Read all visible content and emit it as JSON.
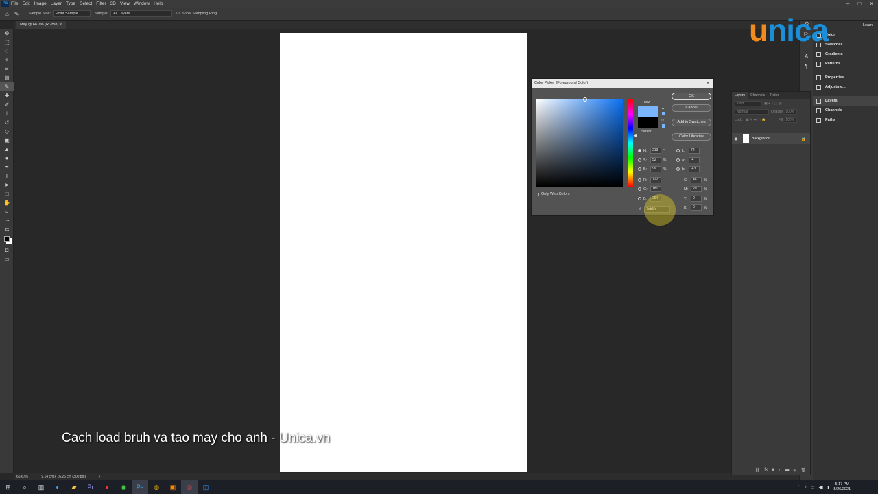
{
  "menubar": {
    "app_icon": "Ps",
    "items": [
      "File",
      "Edit",
      "Image",
      "Layer",
      "Type",
      "Select",
      "Filter",
      "3D",
      "View",
      "Window",
      "Help"
    ]
  },
  "options": {
    "sample_size_label": "Sample Size:",
    "sample_size_value": "Point Sample",
    "sample_label": "Sample:",
    "sample_value": "All Layers",
    "show_ring_label": "Show Sampling Ring"
  },
  "document": {
    "tab_title": "Mây @ 66.7% (RGB/8)",
    "zoom": "66.67%",
    "doc_info": "9.14 cm x 16.26 cm (300 ppi)"
  },
  "right_panel": {
    "items": [
      "Color",
      "Swatches",
      "Gradients",
      "Patterns",
      "Properties",
      "Adjustme...",
      "Layers",
      "Channels",
      "Paths"
    ],
    "learn": "Learn"
  },
  "layers_panel": {
    "tabs": [
      "Layers",
      "Channels",
      "Paths"
    ],
    "kind_placeholder": "Kind",
    "blend_mode": "Normal",
    "opacity_label": "Opacity:",
    "opacity_value": "100%",
    "lock_label": "Lock:",
    "fill_label": "Fill:",
    "fill_value": "100%",
    "layer_name": "Background"
  },
  "color_picker": {
    "title": "Color Picker (Foreground Color)",
    "new_label": "new",
    "current_label": "current",
    "buttons": {
      "ok": "OK",
      "cancel": "Cancel",
      "add": "Add to Swatches",
      "libraries": "Color Libraries"
    },
    "new_color": "#7ab5fe",
    "current_color": "#000000",
    "only_web": "Only Web Colors",
    "hsb": {
      "H": "213",
      "S": "52",
      "B": "99",
      "h_unit": "°",
      "s_unit": "%",
      "b_unit": "%"
    },
    "rgb": {
      "R": "122",
      "G": "181",
      "B": "254"
    },
    "lab": {
      "L": "72",
      "a": "-4",
      "b": "-43"
    },
    "cmyk": {
      "C": "46",
      "M": "20",
      "Y": "0",
      "K": "0",
      "unit": "%"
    },
    "hex_label": "#",
    "hex_value": "7ab5fe"
  },
  "logo": {
    "text1": "u",
    "text2": "nica"
  },
  "caption": "Cach load bruh  va tao may cho anh - Unica.vn",
  "taskbar": {
    "time": "5:17 PM",
    "date": "5/26/2021"
  }
}
